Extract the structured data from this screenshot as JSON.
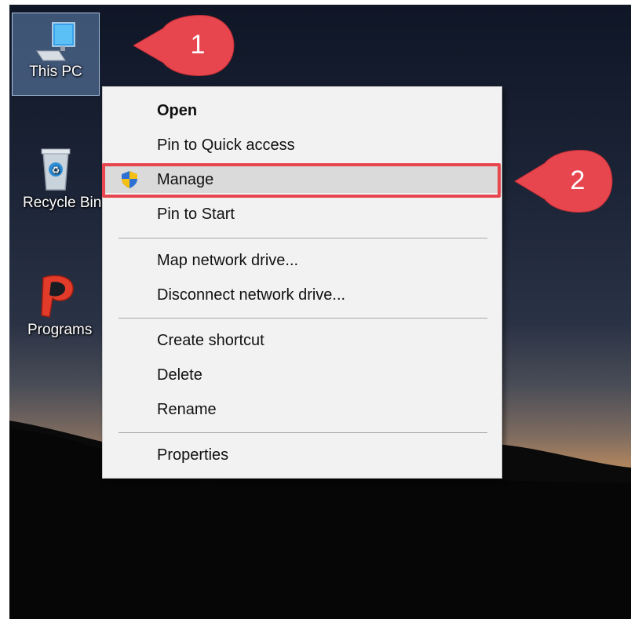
{
  "desktop": {
    "icons": [
      {
        "label": "This PC",
        "icon": "computer-icon"
      },
      {
        "label": "Recycle Bin",
        "icon": "recycle-bin-icon"
      },
      {
        "label": "Programs",
        "icon": "programs-icon"
      }
    ]
  },
  "context_menu": {
    "items": [
      {
        "label": "Open",
        "bold": true
      },
      {
        "label": "Pin to Quick access"
      },
      {
        "label": "Manage",
        "icon": "uac-shield-icon",
        "highlighted": true
      },
      {
        "label": "Pin to Start"
      },
      {
        "label": "Map network drive..."
      },
      {
        "label": "Disconnect network drive..."
      },
      {
        "label": "Create shortcut"
      },
      {
        "label": "Delete"
      },
      {
        "label": "Rename"
      },
      {
        "label": "Properties"
      }
    ]
  },
  "annotations": {
    "callout_1": "1",
    "callout_2": "2",
    "callout_color": "#e8464e",
    "highlight_color": "#e8464e"
  }
}
